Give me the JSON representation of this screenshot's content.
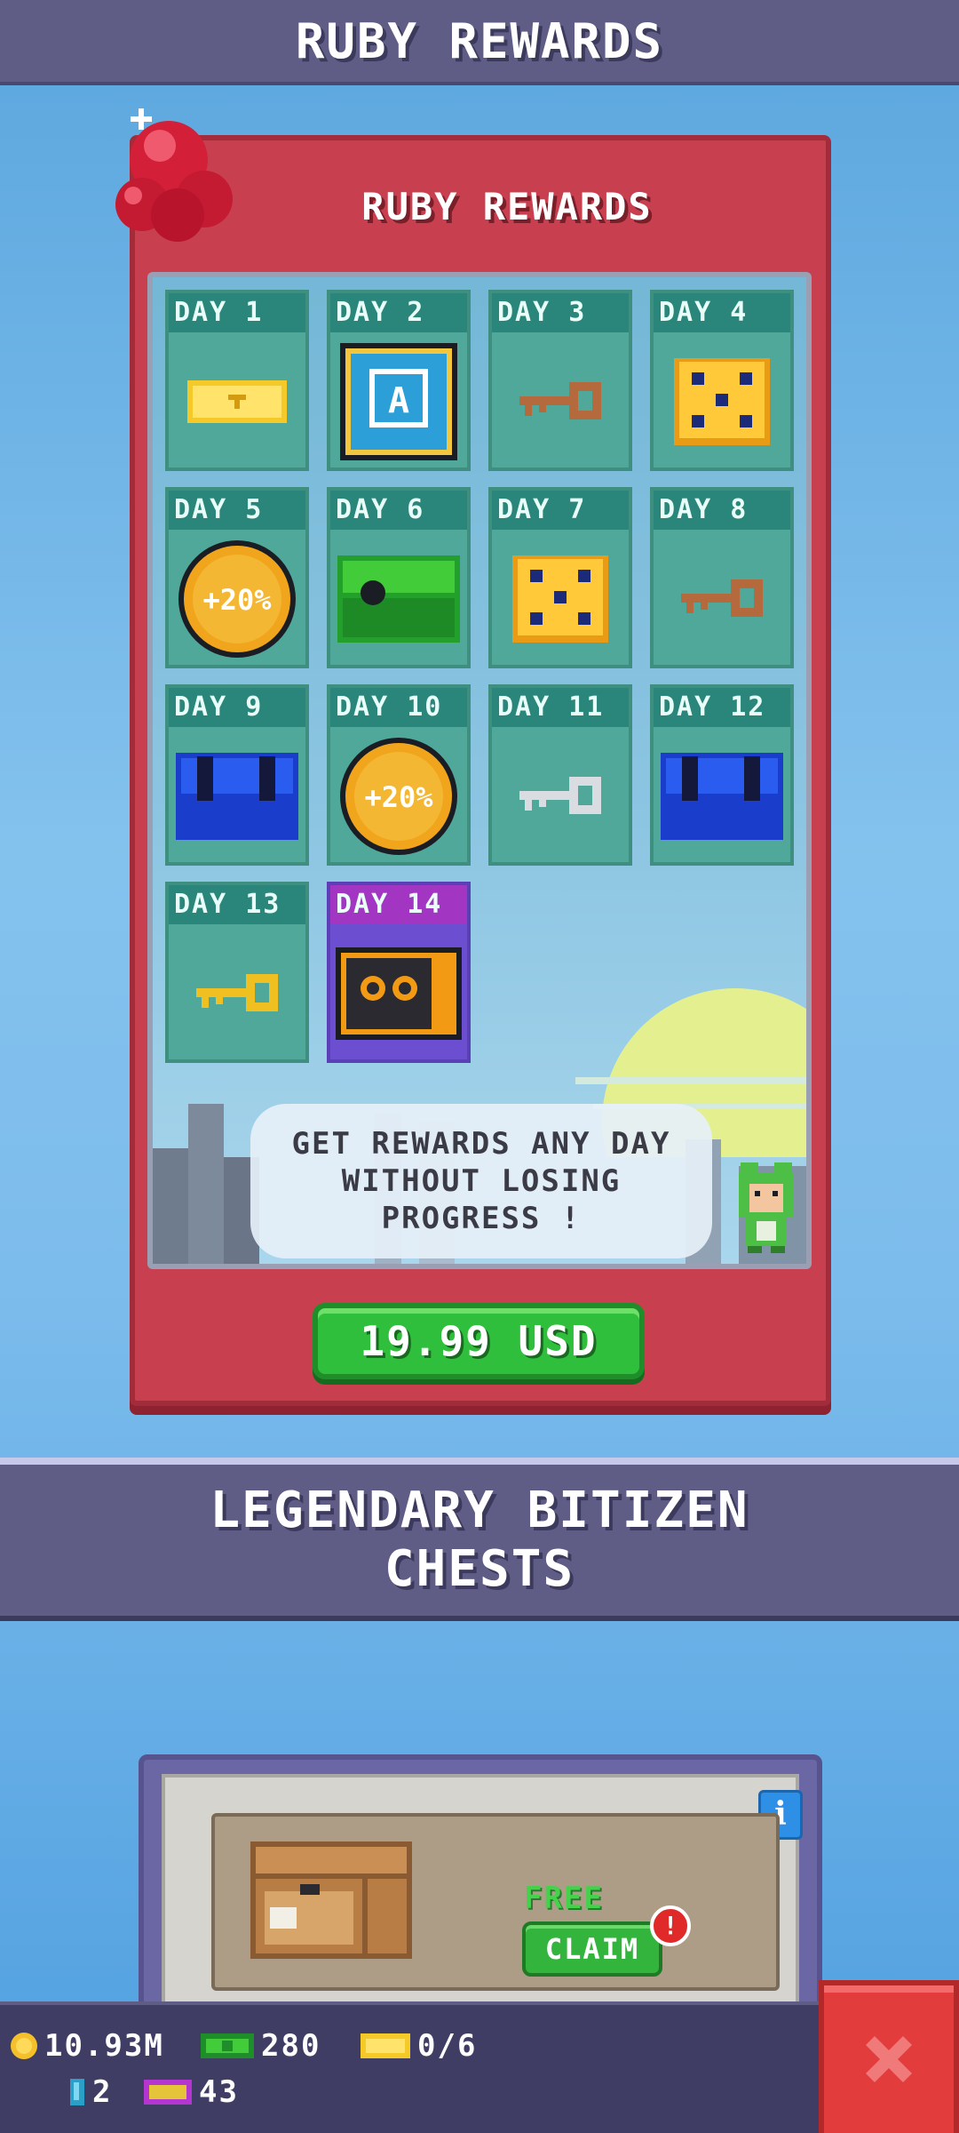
{
  "header": {
    "title": "RUBY REWARDS"
  },
  "ruby_card": {
    "title": "RUBY REWARDS",
    "days": [
      {
        "label": "DAY 1",
        "reward_icon": "golden-ticket-icon"
      },
      {
        "label": "DAY 2",
        "reward_icon": "auto-icon"
      },
      {
        "label": "DAY 3",
        "reward_icon": "bronze-key-icon"
      },
      {
        "label": "DAY 4",
        "reward_icon": "golden-dice-icon"
      },
      {
        "label": "DAY 5",
        "reward_icon": "coin-boost-icon",
        "reward_text": "+20%"
      },
      {
        "label": "DAY 6",
        "reward_icon": "green-chest-icon"
      },
      {
        "label": "DAY 7",
        "reward_icon": "golden-dice-icon"
      },
      {
        "label": "DAY 8",
        "reward_icon": "bronze-key-icon"
      },
      {
        "label": "DAY 9",
        "reward_icon": "blue-chest-icon"
      },
      {
        "label": "DAY 10",
        "reward_icon": "coin-boost-icon",
        "reward_text": "+20%"
      },
      {
        "label": "DAY 11",
        "reward_icon": "silver-key-icon"
      },
      {
        "label": "DAY 12",
        "reward_icon": "blue-chest-icon"
      },
      {
        "label": "DAY 13",
        "reward_icon": "gold-key-icon"
      },
      {
        "label": "DAY 14",
        "reward_icon": "legendary-chest-icon"
      }
    ],
    "message": "GET REWARDS ANY DAY WITHOUT LOSING PROGRESS !",
    "price": "19.99 USD"
  },
  "section": {
    "title_line1": "LEGENDARY BITIZEN",
    "title_line2": "CHESTS"
  },
  "chest_offer": {
    "status": "FREE",
    "claim_label": "CLAIM",
    "alert": "!",
    "info": "i"
  },
  "bottom_bar": {
    "coins": "10.93M",
    "bux": "280",
    "tickets": "0/6",
    "gems": "2",
    "golden_tickets": "43"
  },
  "colors": {
    "accent_red": "#c8404f",
    "green_button": "#2fbf3c",
    "header_purple": "#5f5d86"
  }
}
